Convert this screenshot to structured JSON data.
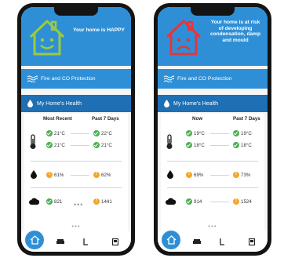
{
  "left": {
    "status": "Your home is HAPPY",
    "fire_label": "Fire and CO Protection",
    "health_label": "My Home's Health",
    "col_left": "Most Recent",
    "col_right": "Past 7 Days",
    "temp_a_left": "21°C",
    "temp_a_right": "22°C",
    "temp_b_left": "21°C",
    "temp_b_right": "21°C",
    "humidity_left": "61%",
    "humidity_right": "62%",
    "co2_left": "821",
    "co2_right": "1441",
    "dots": "•••",
    "pager": "•••"
  },
  "right": {
    "status": "Your home is at risk of developing condensation, damp and mould",
    "fire_label": "Fire and CO Protection",
    "health_label": "My Home's Health",
    "col_left": "Now",
    "col_right": "Past 7 Days",
    "temp_a_left": "19°C",
    "temp_a_right": "19°C",
    "temp_b_left": "18°C",
    "temp_b_right": "18°C",
    "humidity_left": "69%",
    "humidity_right": "73%",
    "co2_left": "914",
    "co2_right": "1524",
    "pager": "•••"
  },
  "colors": {
    "accent": "#2f8fd6",
    "dark_accent": "#1e6fb4",
    "ok": "#4caf50",
    "warn": "#f5a623",
    "happy_house": "#9ccb3b",
    "sad_house": "#e8343a"
  },
  "icons": [
    "house-happy-icon",
    "house-sad-icon",
    "wave-icon",
    "drop-icon",
    "thermometer-icon",
    "humidity-icon",
    "co2-cloud-icon",
    "home-icon",
    "sofa-icon",
    "bed-icon",
    "lamp-icon",
    "tv-icon"
  ]
}
